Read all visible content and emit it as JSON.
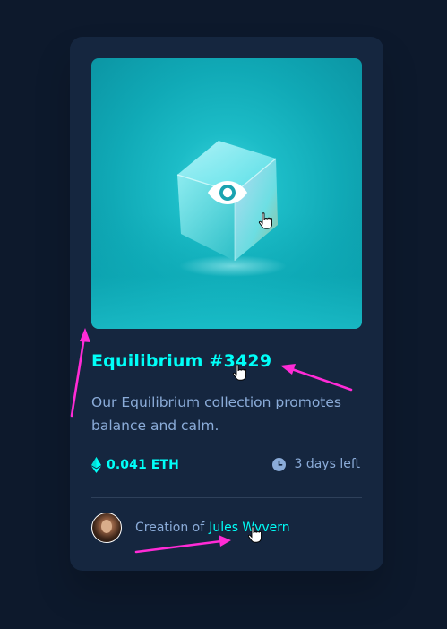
{
  "card": {
    "image_alt": "Equilibrium",
    "view_icon": "eye-icon",
    "title": "Equilibrium #3429",
    "description": "Our Equilibrium collection promotes balance and calm.",
    "price": {
      "icon": "ethereum-icon",
      "text": "0.041 ETH"
    },
    "time": {
      "icon": "clock-icon",
      "text": "3 days left"
    },
    "creator": {
      "prefix": "Creation of",
      "name": "Jules Wyvern"
    }
  },
  "colors": {
    "background": "#0d192c",
    "card": "#15263f",
    "cyan": "#00fff8",
    "soft_blue": "#8bacd9",
    "annotation": "#ff2bd6"
  }
}
